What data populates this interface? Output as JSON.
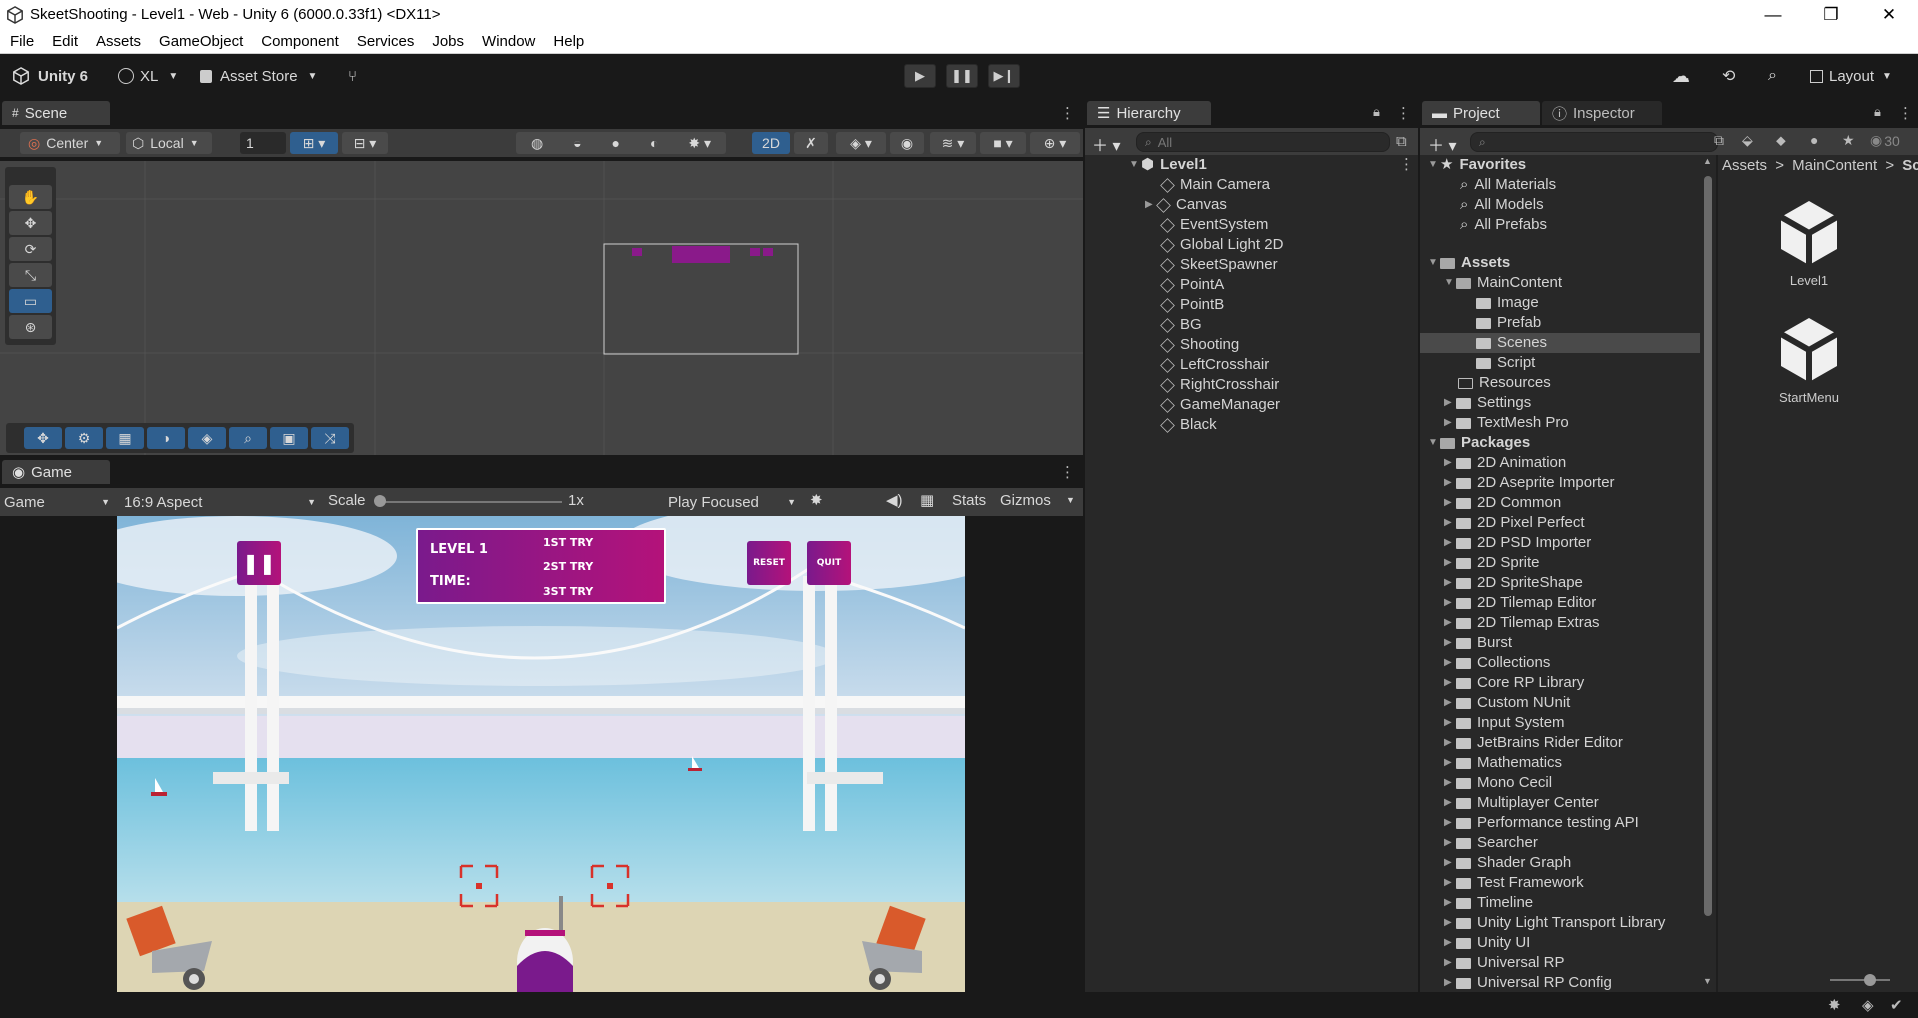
{
  "window": {
    "title": "SkeetShooting - Level1 - Web - Unity 6 (6000.0.33f1) <DX11>",
    "controls": [
      "—",
      "❐",
      "✕"
    ]
  },
  "menu": [
    "File",
    "Edit",
    "Assets",
    "GameObject",
    "Component",
    "Services",
    "Jobs",
    "Window",
    "Help"
  ],
  "toolbar": {
    "app_label": "Unity 6",
    "account": "XL",
    "asset_store": "Asset Store",
    "layout": "Layout"
  },
  "scene": {
    "tab": "Scene",
    "pivot": "Center",
    "space": "Local",
    "grid_value": "1",
    "mode_2d": "2D"
  },
  "game": {
    "tab": "Game",
    "display": "Game",
    "aspect": "16:9 Aspect",
    "scale_label": "Scale",
    "scale_value": "1x",
    "play_mode": "Play Focused",
    "stats": "Stats",
    "gizmos": "Gizmos",
    "hud": {
      "level": "LEVEL 1",
      "time": "TIME:",
      "try1": "1ST TRY",
      "try2": "2ST TRY",
      "try3": "3ST TRY",
      "reset": "RESET",
      "quit": "QUIT"
    }
  },
  "hierarchy": {
    "tab": "Hierarchy",
    "search_placeholder": "All",
    "root": "Level1",
    "items": [
      "Main Camera",
      "Canvas",
      "EventSystem",
      "Global Light 2D",
      "SkeetSpawner",
      "PointA",
      "PointB",
      "BG",
      "Shooting",
      "LeftCrosshair",
      "RightCrosshair",
      "GameManager",
      "Black"
    ]
  },
  "project": {
    "tab": "Project",
    "inspector_tab": "Inspector",
    "count": "30",
    "favorites": "Favorites",
    "fav_items": [
      "All Materials",
      "All Models",
      "All Prefabs"
    ],
    "assets": "Assets",
    "maincontent": "MainContent",
    "mc_children": [
      "Image",
      "Prefab",
      "Scenes",
      "Script"
    ],
    "asset_children": [
      "Resources",
      "Settings",
      "TextMesh Pro"
    ],
    "packages": "Packages",
    "package_items": [
      "2D Animation",
      "2D Aseprite Importer",
      "2D Common",
      "2D Pixel Perfect",
      "2D PSD Importer",
      "2D Sprite",
      "2D SpriteShape",
      "2D Tilemap Editor",
      "2D Tilemap Extras",
      "Burst",
      "Collections",
      "Core RP Library",
      "Custom NUnit",
      "Input System",
      "JetBrains Rider Editor",
      "Mathematics",
      "Mono Cecil",
      "Multiplayer Center",
      "Performance testing API",
      "Searcher",
      "Shader Graph",
      "Test Framework",
      "Timeline",
      "Unity Light Transport Library",
      "Unity UI",
      "Universal RP",
      "Universal RP Config"
    ],
    "breadcrumb": [
      "Assets",
      "MainContent",
      "Sc"
    ],
    "grid_items": [
      "Level1",
      "StartMenu"
    ]
  },
  "colors": {
    "accent": "#2c5d87",
    "hud_purple": "#8a1a8a",
    "crosshair": "#d8322a"
  }
}
